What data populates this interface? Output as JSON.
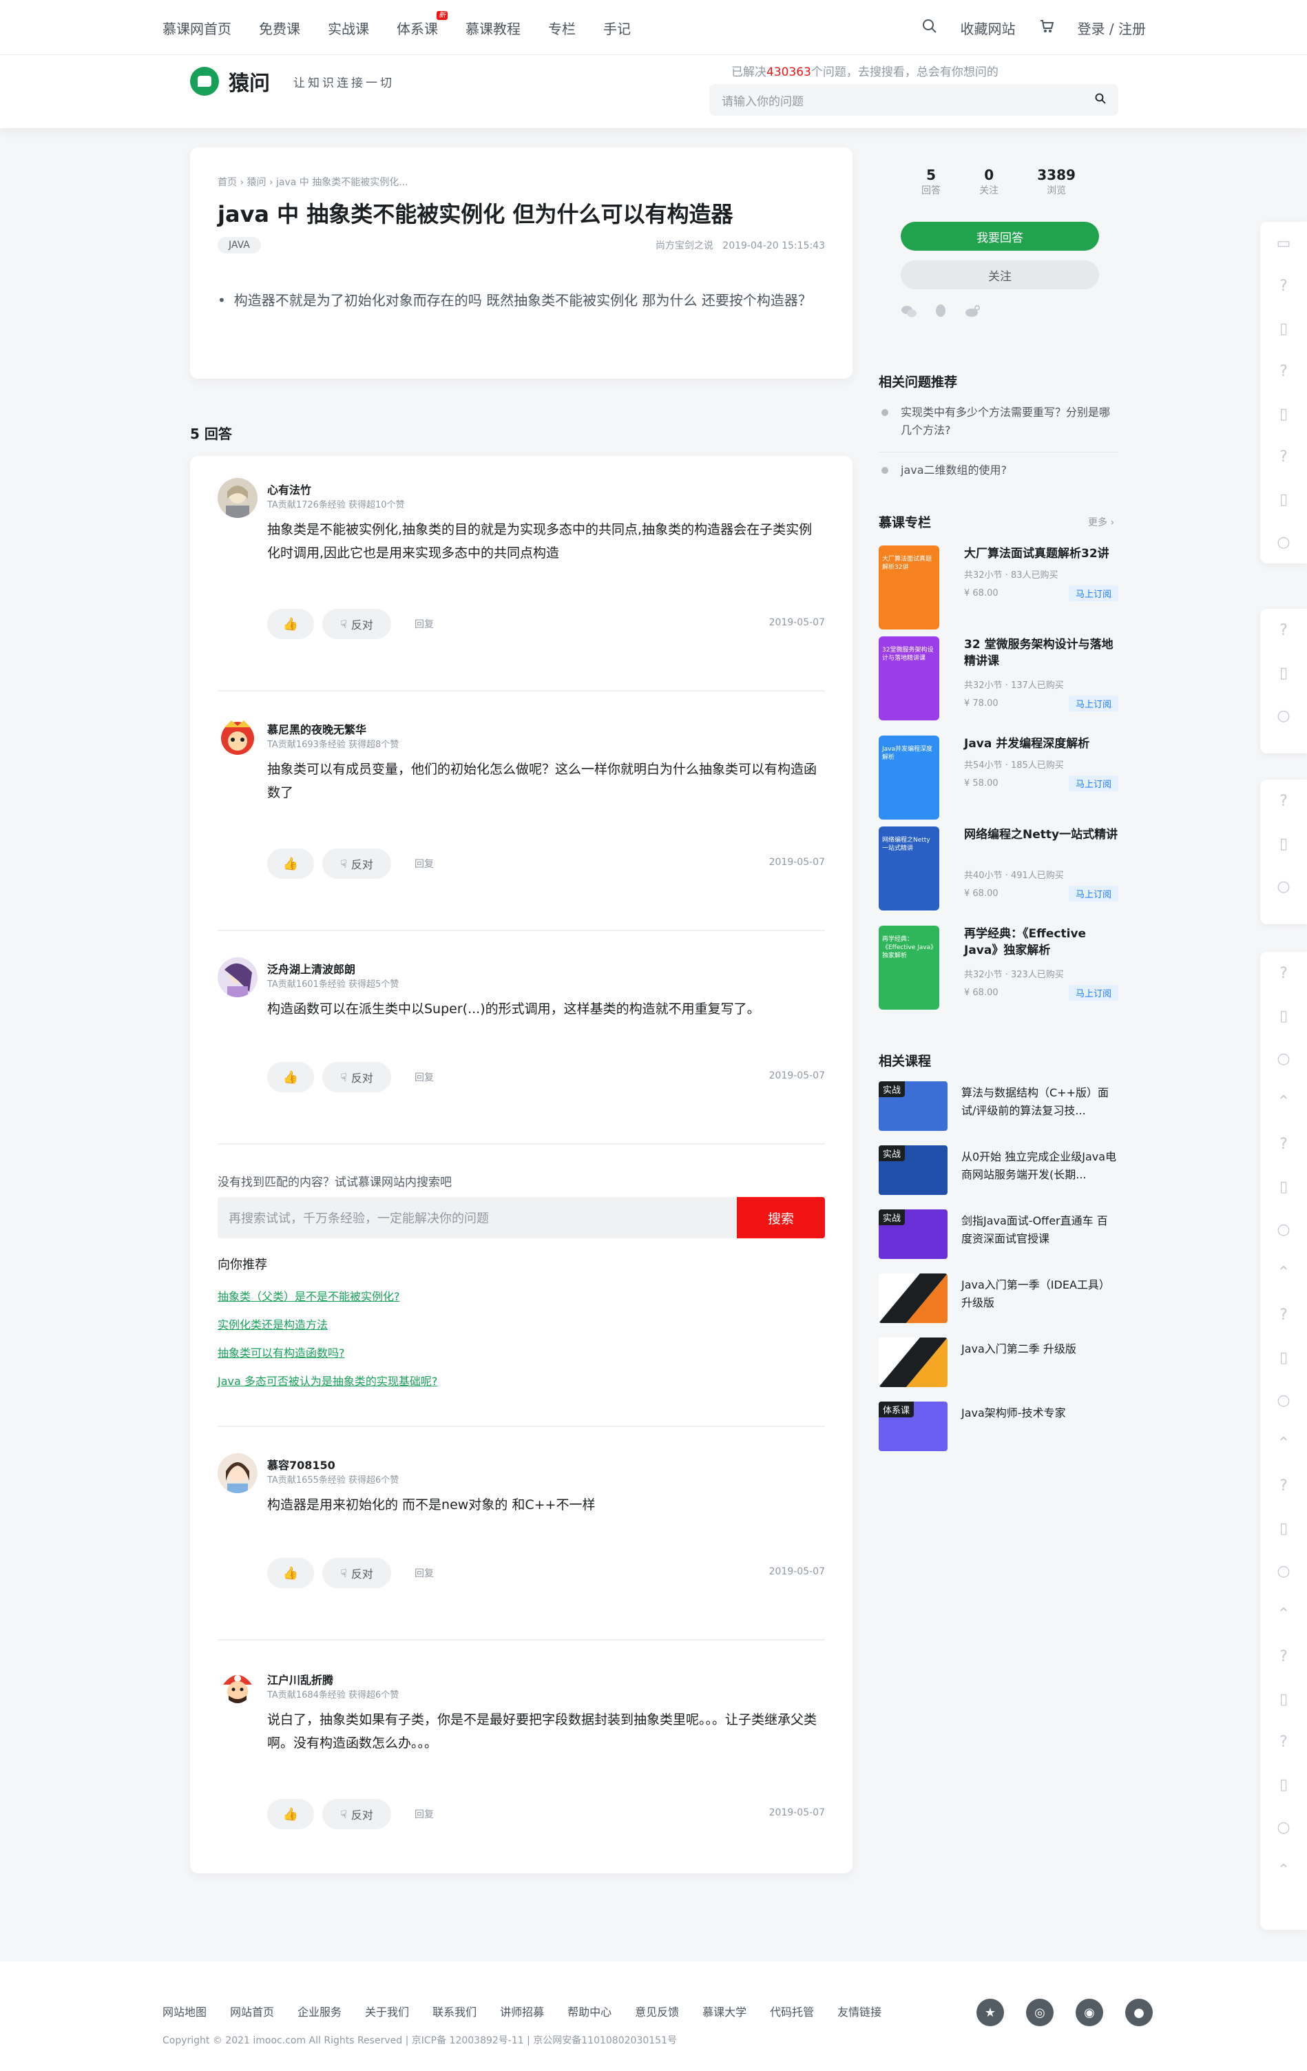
{
  "nav": {
    "items": [
      "慕课网首页",
      "免费课",
      "实战课",
      "体系课",
      "慕课教程",
      "专栏",
      "手记"
    ],
    "hot_badge": "新",
    "favorite": "收藏网站",
    "login": "登录 / 注册"
  },
  "header": {
    "logo_name": "猿问",
    "slogan": "让知识连接一切",
    "solved_prefix": "已解决",
    "solved_count": "430363",
    "solved_suffix": "个问题，去搜搜看，总会有你想问的",
    "search_placeholder": "请输入你的问题"
  },
  "question": {
    "crumbs": [
      "首页",
      "猿问",
      "java 中 抽象类不能被实例化..."
    ],
    "title": "java 中 抽象类不能被实例化 但为什么可以有构造器",
    "tag": "JAVA",
    "author": "尚方宝剑之说",
    "time": "2019-04-20 15:15:43",
    "body": "构造器不就是为了初始化对象而存在的吗 既然抽象类不能被实例化 那为什么 还要按个构造器？"
  },
  "answers_title": "5 回答",
  "labels": {
    "oppose": "反对",
    "reply": "回复"
  },
  "answers": [
    {
      "name": "心有法竹",
      "contrib": "TA贡献1726条经验 获得超10个赞",
      "content": "抽象类是不能被实例化,抽象类的目的就是为实现多态中的共同点,抽象类的构造器会在子类实例化时调用,因此它也是用来实现多态中的共同点构造",
      "date": "2019-05-07"
    },
    {
      "name": "慕尼黑的夜晚无繁华",
      "contrib": "TA贡献1693条经验 获得超8个赞",
      "content": "抽象类可以有成员变量，他们的初始化怎么做呢？这么一样你就明白为什么抽象类可以有构造函数了",
      "date": "2019-05-07"
    },
    {
      "name": "泛舟湖上清波郎朗",
      "contrib": "TA贡献1601条经验 获得超5个赞",
      "content": "构造函数可以在派生类中以Super(...)的形式调用，这样基类的构造就不用重复写了。",
      "date": "2019-05-07"
    },
    {
      "name": "慕容708150",
      "contrib": "TA贡献1655条经验 获得超6个赞",
      "content": "构造器是用来初始化的 而不是new对象的 和C++不一样",
      "date": "2019-05-07"
    },
    {
      "name": "江户川乱折腾",
      "contrib": "TA贡献1684条经验 获得超6个赞",
      "content": "说白了，抽象类如果有子类，你是不是最好要把字段数据封装到抽象类里呢。。。让子类继承父类啊。没有构造函数怎么办。。。",
      "date": "2019-05-07"
    }
  ],
  "ask": {
    "hint": "没有找到匹配的内容？试试慕课网站内搜索吧",
    "placeholder": "再搜索试试，千万条经验，一定能解决你的问题",
    "button": "搜索",
    "recommend_title": "向你推荐",
    "recommend": [
      "抽象类（父类）是不是不能被实例化?",
      "实例化类还是构造方法",
      "抽象类可以有构造函数吗?",
      "Java 多态可否被认为是抽象类的实现基础呢?"
    ]
  },
  "sidebar": {
    "stats": [
      {
        "value": "5",
        "label": "回答"
      },
      {
        "value": "0",
        "label": "关注"
      },
      {
        "value": "3389",
        "label": "浏览"
      }
    ],
    "answer_button": "我要回答",
    "follow_button": "关注",
    "related_title": "相关问题推荐",
    "related": [
      "实现类中有多少个方法需要重写？分别是哪几个方法?",
      "java二维数组的使用?"
    ],
    "columns_title": "慕课专栏",
    "more": "更多",
    "columns": [
      {
        "cover_text": "大厂算法面试真题解析32讲",
        "title": "大厂算法面试真题解析32讲",
        "meta": "共32小节 · 83人已购买",
        "price": "¥ 68.00",
        "sub": "马上订阅",
        "color": "#f5821f"
      },
      {
        "cover_text": "32堂微服务架构设计与落地精讲课",
        "title": "32 堂微服务架构设计与落地精讲课",
        "meta": "共32小节 · 137人已购买",
        "price": "¥ 78.00",
        "sub": "马上订阅",
        "color": "#9b3de8"
      },
      {
        "cover_text": "Java并发编程深度解析",
        "title": "Java 并发编程深度解析",
        "meta": "共54小节 · 185人已购买",
        "price": "¥ 58.00",
        "sub": "马上订阅",
        "color": "#2f8ef5"
      },
      {
        "cover_text": "网络编程之Netty一站式精讲",
        "title": "网络编程之Netty一站式精讲",
        "meta": "共40小节 · 491人已购买",
        "price": "¥ 68.00",
        "sub": "马上订阅",
        "color": "#2a5fc4"
      },
      {
        "cover_text": "再学经典：《Effective Java》独家解析",
        "title": "再学经典：《Effective Java》独家解析",
        "meta": "共32小节 · 323人已购买",
        "price": "¥ 68.00",
        "sub": "马上订阅",
        "color": "#2fb55a"
      }
    ],
    "courses_title": "相关课程",
    "courses": [
      {
        "badge": "实战",
        "name": "算法与数据结构（C++版）面试/评级前的算法复习技...",
        "color": "#3b6fd6"
      },
      {
        "badge": "实战",
        "name": "从0开始 独立完成企业级Java电商网站服务端开发(长期...",
        "color": "#1f4fa8"
      },
      {
        "badge": "实战",
        "name": "剑指Java面试-Offer直通车 百度资深面试官授课",
        "color": "#6b2fd8"
      },
      {
        "badge": "",
        "name": "Java入门第一季（IDEA工具）升级版",
        "color": "#f07a1f"
      },
      {
        "badge": "",
        "name": "Java入门第二季 升级版",
        "color": "#f5a623"
      },
      {
        "badge": "体系课",
        "name": "Java架构师-技术专家",
        "color": "#6a5ff0"
      }
    ]
  },
  "footer": {
    "links": [
      "网站地图",
      "网站首页",
      "企业服务",
      "关于我们",
      "联系我们",
      "讲师招募",
      "帮助中心",
      "意见反馈",
      "慕课大学",
      "代码托管",
      "友情链接"
    ],
    "copyright": "Copyright © 2021 imooc.com All Rights Reserved | 京ICP备 12003892号-11 | 京公网安备11010802030151号"
  }
}
